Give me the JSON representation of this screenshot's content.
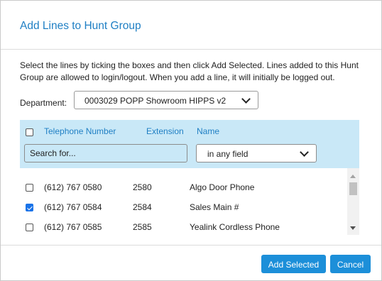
{
  "dialog": {
    "title": "Add Lines to Hunt Group",
    "description": "Select the lines by ticking the boxes and then click Add Selected. Lines added to this Hunt Group are allowed to login/logout. When you add a line, it will initially be logged out."
  },
  "department": {
    "label": "Department:",
    "selected": "0003029 POPP Showroom HIPPS v2"
  },
  "table": {
    "headers": {
      "telephone": "Telephone Number",
      "extension": "Extension",
      "name": "Name"
    },
    "search_placeholder": "Search for...",
    "field_filter": "in any field",
    "rows": [
      {
        "checked": false,
        "telephone": "(612) 767 0580",
        "extension": "2580",
        "name": "Algo Door Phone"
      },
      {
        "checked": true,
        "telephone": "(612) 767 0584",
        "extension": "2584",
        "name": "Sales Main #"
      },
      {
        "checked": false,
        "telephone": "(612) 767 0585",
        "extension": "2585",
        "name": "Yealink Cordless Phone"
      }
    ]
  },
  "buttons": {
    "add_selected": "Add Selected",
    "cancel": "Cancel"
  },
  "colors": {
    "accent": "#1f7fc4",
    "button": "#1c8fd9",
    "header_bg": "#c9e8f7",
    "checkbox_checked": "#1a73e8"
  }
}
